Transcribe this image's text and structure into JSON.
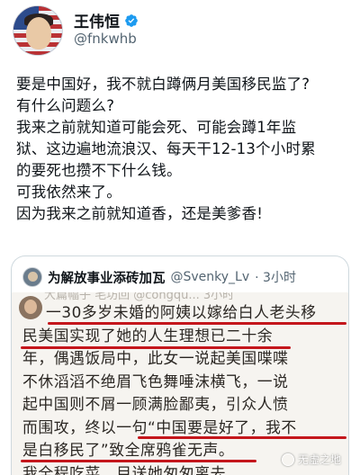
{
  "tweet": {
    "author_name": "王伟恒",
    "handle": "@fnkwhb",
    "lines": [
      "要是中国好，我不就白蹲俩月美国移民监了?",
      "有什么问题么?",
      "我来之前就知道可能会死、可能会蹲1年监",
      "狱、这边遍地流浪汉、每天干12-13个小时累",
      "的要死也攒不下什么钱。",
      "可我依然来了。",
      "因为我来之前就知道香，还是美爹香!"
    ]
  },
  "quote": {
    "author_name": "为解放事业添砖加瓦",
    "handle": "@Svenky_Lv",
    "time": "· 3小时",
    "faded_top": "大篇幅子 毛坊回  @congqu...   3小时",
    "image_lines": [
      "一30多岁未婚的阿姨以嫁给白人老头移",
      "民美国实现了她的人生理想已二十余",
      "年，偶遇饭局中，此女一说起美国喋喋",
      "不休滔滔不绝眉飞色舞唾沫横飞，一说",
      "起中国则不屑一顾满脸鄙夷，引众人愤",
      "而围攻，终以一句“中国要是好了，我不",
      "是白移民了”致全席鸦雀无声。",
      "我全程吃菜，目送她匆匆离去。"
    ],
    "watermark": "无虚之地"
  },
  "colors": {
    "verified": "#1d9bf0",
    "underline": "#c4161c",
    "secondary_text": "#536471"
  },
  "icons": {
    "verified": "verified-badge-icon"
  }
}
